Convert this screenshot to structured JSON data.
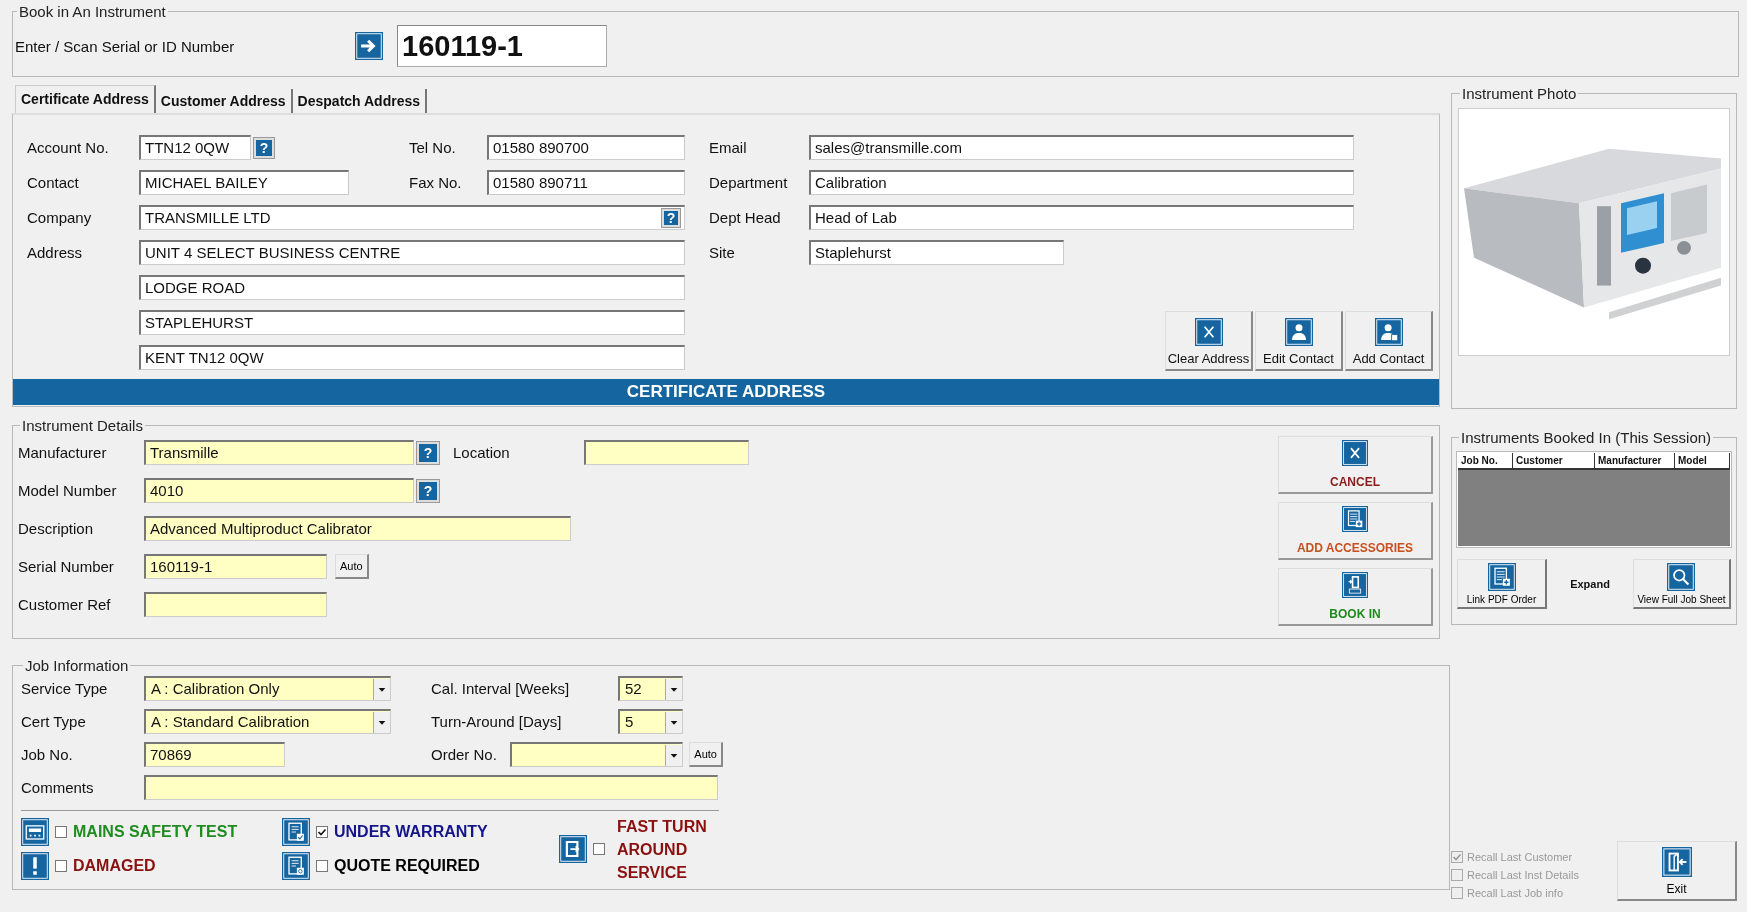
{
  "book_in": {
    "title": "Book in An Instrument",
    "label": "Enter / Scan Serial or ID Number",
    "value": "160119-1"
  },
  "address_tabs": [
    {
      "label": "Certificate Address",
      "selected": true
    },
    {
      "label": "Customer Address",
      "selected": false
    },
    {
      "label": "Despatch Address",
      "selected": false
    }
  ],
  "address": {
    "account": {
      "label": "Account No.",
      "value": "TTN12 0QW",
      "lookup": "?"
    },
    "contact": {
      "label": "Contact",
      "value": "MICHAEL BAILEY"
    },
    "company": {
      "label": "Company",
      "value": "TRANSMILLE LTD",
      "lookup": "?"
    },
    "address_label": "Address",
    "address_lines": [
      "UNIT 4 SELECT BUSINESS CENTRE",
      "LODGE ROAD",
      "STAPLEHURST",
      "KENT TN12 0QW"
    ],
    "phones": [
      {
        "label": "Tel No.",
        "value": "01580 890700"
      },
      {
        "label": "Fax No.",
        "value": "01580 890711"
      }
    ],
    "other_fields": [
      {
        "label": "Email",
        "value": "sales@transmille.com"
      },
      {
        "label": "Department",
        "value": "Calibration"
      },
      {
        "label": "Dept Head",
        "value": "Head of Lab"
      },
      {
        "label": "Site",
        "value": "Staplehurst"
      }
    ],
    "buttons": [
      {
        "label": "Clear Address",
        "kind": "clear"
      },
      {
        "label": "Edit Contact",
        "kind": "person"
      },
      {
        "label": "Add Contact",
        "kind": "person_add"
      }
    ],
    "banner": "CERTIFICATE ADDRESS"
  },
  "photo": {
    "title": "Instrument Photo",
    "kind": "picture"
  },
  "instrument": {
    "title": "Instrument Details",
    "fields": [
      {
        "label": "Manufacturer",
        "value": "Transmille",
        "lookup": "?"
      },
      {
        "label": "Model Number",
        "value": "4010",
        "lookup": "?"
      },
      {
        "label": "Description",
        "value": "Advanced Multiproduct Calibrator"
      },
      {
        "label": "Serial Number",
        "value": "160119-1",
        "button": "Auto"
      },
      {
        "label": "Customer Ref"
      }
    ],
    "location": {
      "label": "Location"
    },
    "actions": [
      {
        "label": "CANCEL",
        "kind": "cancel",
        "color": "#8b1a1a"
      },
      {
        "label": "ADD ACCESSORIES",
        "kind": "accessories",
        "color": "#c8501e"
      },
      {
        "label": "BOOK IN",
        "kind": "book",
        "color": "#1e8a1e"
      }
    ]
  },
  "booked": {
    "title": "Instruments Booked In (This Session)",
    "columns": [
      "Job No.",
      "Customer",
      "Manufacturer",
      "Model"
    ],
    "buttons": [
      {
        "label": "Link PDF Order",
        "kind": "pdf"
      },
      {
        "label": "View Full Job Sheet",
        "kind": "view"
      }
    ],
    "expand": "Expand"
  },
  "job": {
    "title": "Job Information",
    "left": [
      {
        "label": "Service Type",
        "value": "A : Calibration Only",
        "kind": "dropdown"
      },
      {
        "label": "Cert Type",
        "value": "A : Standard Calibration",
        "kind": "dropdown"
      },
      {
        "label": "Job No.",
        "value": "70869",
        "kind": "text"
      }
    ],
    "right": [
      {
        "label": "Cal. Interval [Weeks]",
        "value": "52",
        "kind": "dropdown"
      },
      {
        "label": "Turn-Around [Days]",
        "value": "5",
        "kind": "dropdown"
      },
      {
        "label": "Order No.",
        "kind": "dropdown",
        "button": "Auto"
      }
    ],
    "comments": {
      "label": "Comments"
    },
    "flags": [
      {
        "label": "MAINS SAFETY TEST",
        "checked": false,
        "kind": "safety",
        "color": "#1e8c1e"
      },
      {
        "label": "DAMAGED",
        "checked": false,
        "kind": "damaged",
        "color": "#8b1010"
      },
      {
        "label": "UNDER WARRANTY",
        "checked": true,
        "kind": "warranty",
        "color": "#14148c"
      },
      {
        "label": "QUOTE REQUIRED",
        "checked": false,
        "kind": "quote",
        "color": "#000000"
      },
      {
        "label": "FAST TURN AROUND SERVICE",
        "checked": false,
        "kind": "fast",
        "color": "#8b1010"
      }
    ]
  },
  "recall": [
    {
      "label": "Recall Last Customer",
      "checked": true,
      "disabled": true
    },
    {
      "label": "Recall Last Inst Details",
      "checked": false,
      "disabled": true
    },
    {
      "label": "Recall Last Job info",
      "checked": false,
      "disabled": true
    }
  ],
  "exit": {
    "label": "Exit",
    "kind": "exit"
  }
}
